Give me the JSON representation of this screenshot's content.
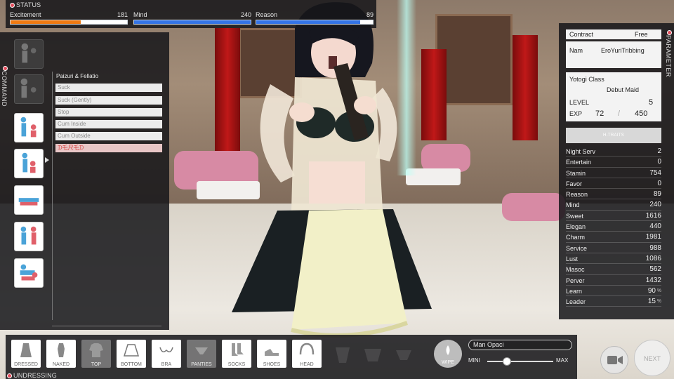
{
  "status": {
    "title": "STATUS",
    "stats": [
      {
        "label": "Excitement",
        "value": "181",
        "fill": 0.6,
        "color": "#f07a12"
      },
      {
        "label": "Mind",
        "value": "240",
        "fill": 1.0,
        "color": "#3474e6"
      },
      {
        "label": "Reason",
        "value": "89",
        "fill": 0.89,
        "color": "#3474e6"
      }
    ]
  },
  "command": {
    "title": "COMMAND",
    "section_title": "Paizuri & Fellatio",
    "items": [
      {
        "label": "Suck"
      },
      {
        "label": "Suck (Gently)"
      },
      {
        "label": "Stop"
      },
      {
        "label": "Cum Inside"
      },
      {
        "label": "Cum Outside"
      },
      {
        "label": "ᗪ乇尺乇ᗪ"
      }
    ],
    "icons": [
      "pose-icon-1",
      "pose-icon-2",
      "pose-icon-3",
      "pose-icon-4",
      "pose-icon-5",
      "pose-icon-6",
      "pose-icon-7"
    ]
  },
  "parameter": {
    "title": "PARAMETER",
    "contract_label": "Contract",
    "contract_value": "Free",
    "name_label": "Nam",
    "name_value": "EroYuriTribbing",
    "yotogi_label": "Yotogi Class",
    "yotogi_value": "Debut Maid",
    "level_label": "LEVEL",
    "level_value": "5",
    "exp_label": "EXP",
    "exp_value": "72",
    "exp_sep": "/",
    "exp_max": "450",
    "traits_label": "H-TRAITS",
    "rows": [
      {
        "label": "Night Serv",
        "value": "2"
      },
      {
        "label": "Entertain",
        "value": "0"
      },
      {
        "label": "Stamin",
        "value": "754"
      },
      {
        "label": "Favor",
        "value": "0"
      },
      {
        "label": "Reason",
        "value": "89"
      },
      {
        "label": "Mind",
        "value": "240"
      },
      {
        "label": "Sweet",
        "value": "1616"
      },
      {
        "label": "Elegan",
        "value": "440"
      },
      {
        "label": "Charm",
        "value": "1981"
      },
      {
        "label": "Service",
        "value": "988"
      },
      {
        "label": "Lust",
        "value": "1086"
      },
      {
        "label": "Masoc",
        "value": "562"
      },
      {
        "label": "Perver",
        "value": "1432"
      },
      {
        "label": "Learn",
        "value": "90",
        "pct": "%"
      },
      {
        "label": "Leader",
        "value": "15",
        "pct": "%"
      }
    ]
  },
  "undressing": {
    "title": "UNDRESSING",
    "buttons": [
      {
        "label": "DRESSED",
        "icon": "dress-icon",
        "active": true
      },
      {
        "label": "NAKED",
        "icon": "body-icon",
        "active": true
      },
      {
        "label": "TOP",
        "icon": "top-icon",
        "active": false
      },
      {
        "label": "BOTTOM",
        "icon": "skirt-icon",
        "active": true
      },
      {
        "label": "BRA",
        "icon": "bra-icon",
        "active": true
      },
      {
        "label": "PANTIES",
        "icon": "panties-icon",
        "active": false
      },
      {
        "label": "SOCKS",
        "icon": "socks-icon",
        "active": true
      },
      {
        "label": "SHOES",
        "icon": "shoes-icon",
        "active": true
      },
      {
        "label": "HEAD",
        "icon": "headband-icon",
        "active": true
      }
    ],
    "wipe_label": "WIPE",
    "man_value": "Man Opaci",
    "slider_min": "MINI",
    "slider_max": "MAX",
    "slider_level": 0.3
  },
  "next_label": "NEXT",
  "colors": {
    "panel": "#16161a",
    "accent_red": "#e24b5a",
    "curtain": "#c01818"
  }
}
